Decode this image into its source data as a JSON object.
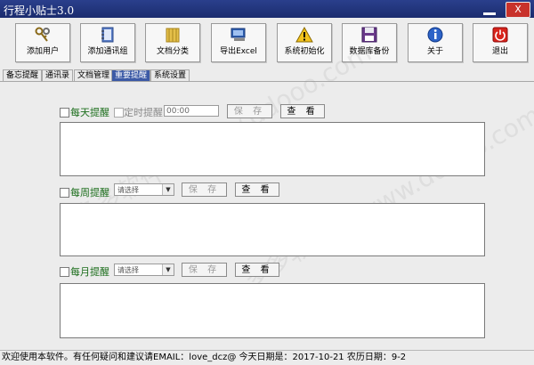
{
  "window": {
    "title": "行程小贴士3.0",
    "close_label": "X"
  },
  "toolbar": [
    {
      "label": "添加用户",
      "icon": "keys-icon"
    },
    {
      "label": "添加通讯组",
      "icon": "contact-book-icon"
    },
    {
      "label": "文档分类",
      "icon": "folder-icon"
    },
    {
      "label": "导出Excel",
      "icon": "computer-export-icon"
    },
    {
      "label": "系统初始化",
      "icon": "warning-icon"
    },
    {
      "label": "数据库备份",
      "icon": "floppy-disk-icon"
    },
    {
      "label": "关于",
      "icon": "info-icon"
    },
    {
      "label": "退出",
      "icon": "power-icon"
    }
  ],
  "tabs": [
    {
      "label": "备忘提醒",
      "active": false
    },
    {
      "label": "通讯录",
      "active": false
    },
    {
      "label": "文档管理",
      "active": false
    },
    {
      "label": "重要提醒",
      "active": true
    },
    {
      "label": "系统设置",
      "active": false
    }
  ],
  "daily": {
    "label": "每天提醒",
    "timed_label": "定时提醒",
    "time_value": "00:00",
    "save": "保 存",
    "view": "查 看"
  },
  "weekly": {
    "label": "每周提醒",
    "select": "请选择",
    "save": "保 存",
    "view": "查 看"
  },
  "monthly": {
    "label": "每月提醒",
    "select": "请选择",
    "save": "保 存",
    "view": "查 看"
  },
  "watermark": "多多软件站 www.ddooo.com",
  "status": {
    "text": "欢迎使用本软件。有任何疑问和建议请EMAIL：love_dcz@  今天日期是：2017-10-21   农历日期：9-2"
  },
  "colors": {
    "titlebar": "#1b2c6e",
    "section_label": "#1c6e1c",
    "active_tab": "#3c5aa6",
    "close": "#c8322b"
  }
}
